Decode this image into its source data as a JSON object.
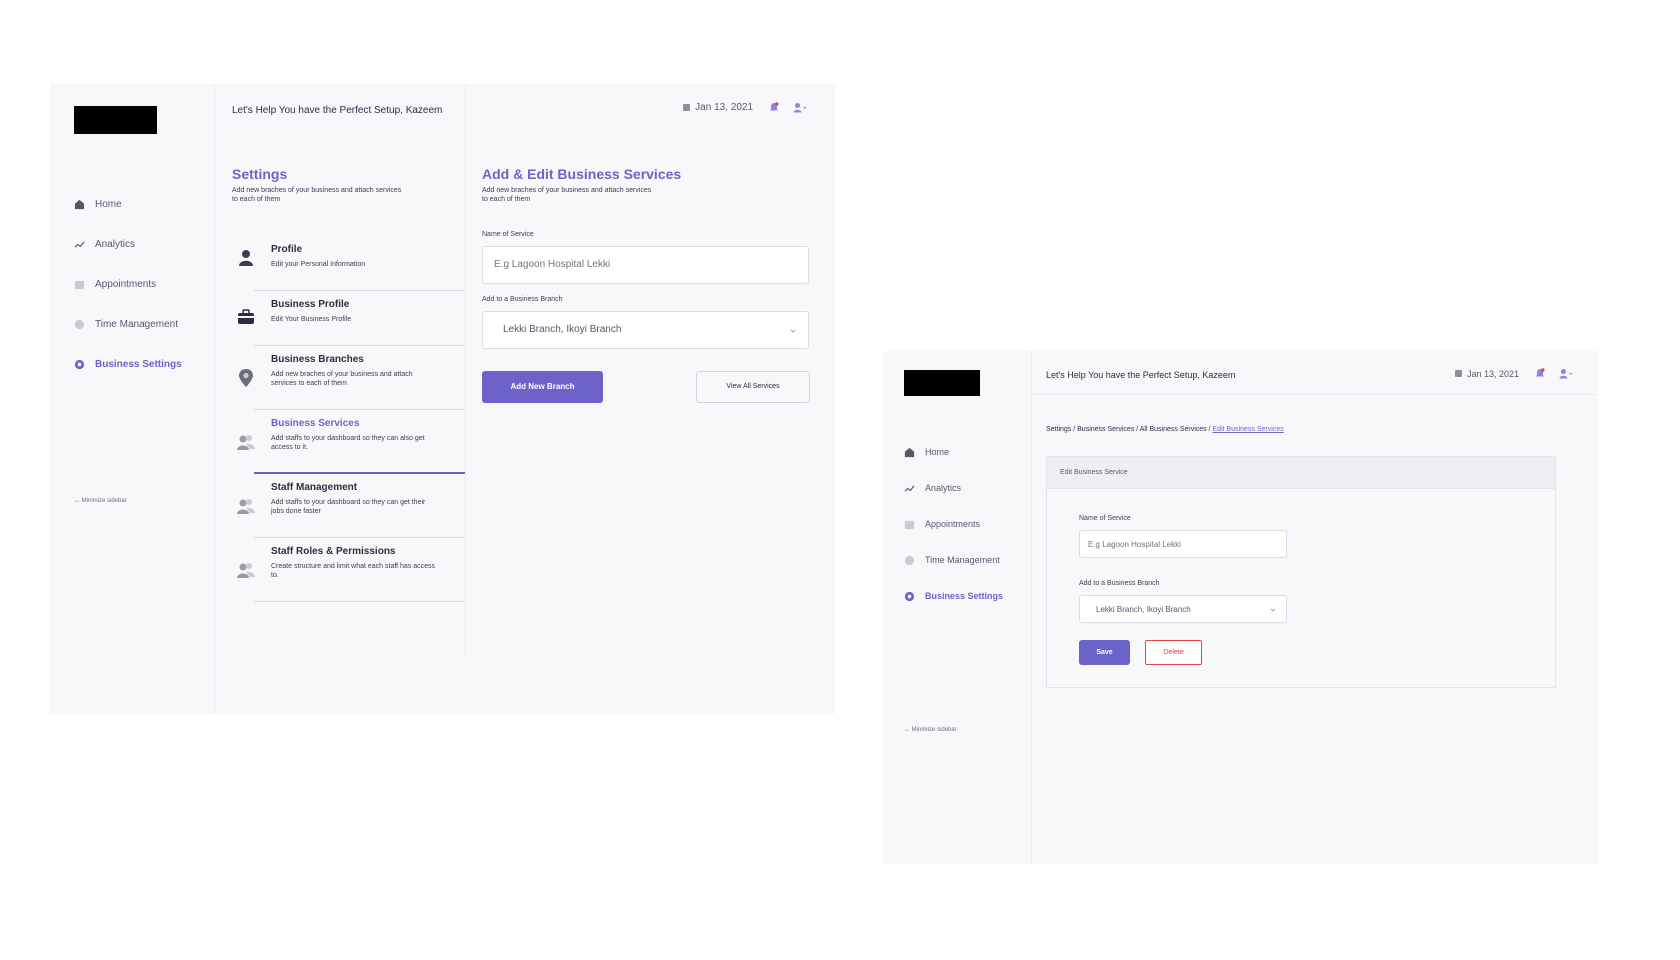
{
  "colors": {
    "accent": "#6c63c8",
    "danger": "#e14545",
    "logo": "#000000"
  },
  "screen1": {
    "header": {
      "welcome": "Let's Help You have the Perfect Setup, Kazeem",
      "date": "Jan 13, 2021"
    },
    "sidebar": {
      "items": [
        {
          "label": "Home",
          "icon": "home-icon"
        },
        {
          "label": "Analytics",
          "icon": "analytics-icon"
        },
        {
          "label": "Appointments",
          "icon": "calendar-icon"
        },
        {
          "label": "Time Management",
          "icon": "clock-icon"
        },
        {
          "label": "Business Settings",
          "icon": "gear-icon",
          "active": true
        }
      ],
      "minimize": "↔ Minimize sidebar"
    },
    "settings": {
      "title": "Settings",
      "subtitle": "Add new braches of your business and attach services to each of them",
      "menu": [
        {
          "title": "Profile",
          "desc": "Edit your Personal Information",
          "icon": "user-icon"
        },
        {
          "title": "Business Profile",
          "desc": "Edit Your Business Profile",
          "icon": "briefcase-icon"
        },
        {
          "title": "Business Branches",
          "desc": "Add new braches of your business and attach services to each of them",
          "icon": "location-pin-icon"
        },
        {
          "title": "Business Services",
          "desc": "Add staffs to your dashboard so they can also get access to it.",
          "icon": "users-icon",
          "active": true
        },
        {
          "title": "Staff Management",
          "desc": "Add staffs to your dashboard so they can get their jobs done faster",
          "icon": "users-icon"
        },
        {
          "title": "Staff Roles & Permissions",
          "desc": "Create structure and limit what each staff has access to.",
          "icon": "users-icon"
        }
      ]
    },
    "form": {
      "title": "Add & Edit Business Services",
      "subtitle": "Add new braches of your business and attach services to each of them",
      "service_label": "Name of Service",
      "service_placeholder": "E.g Lagoon Hospital Lekki",
      "branch_label": "Add to a Business Branch",
      "branch_value": "Lekki Branch, Ikoyi Branch",
      "add_button": "Add New Branch",
      "view_button": "View All Services"
    }
  },
  "screen2": {
    "header": {
      "welcome": "Let's Help You have the Perfect Setup, Kazeem",
      "date": "Jan 13, 2021"
    },
    "sidebar": {
      "items": [
        {
          "label": "Home"
        },
        {
          "label": "Analytics"
        },
        {
          "label": "Appointments"
        },
        {
          "label": "Time Management"
        },
        {
          "label": "Business Settings",
          "active": true
        }
      ],
      "minimize": "↔ Minimize sidebar"
    },
    "breadcrumb": {
      "path": "Settings / Business Services / All Business Services / ",
      "current": "Edit Business Services"
    },
    "card": {
      "title": "Edit Business Service",
      "service_label": "Name of Service",
      "service_placeholder": "E.g Lagoon Hospital Lekki",
      "branch_label": "Add to a Business Branch",
      "branch_value": "Lekki Branch, Ikoyi Branch",
      "save_button": "Save",
      "delete_button": "Delete"
    }
  }
}
